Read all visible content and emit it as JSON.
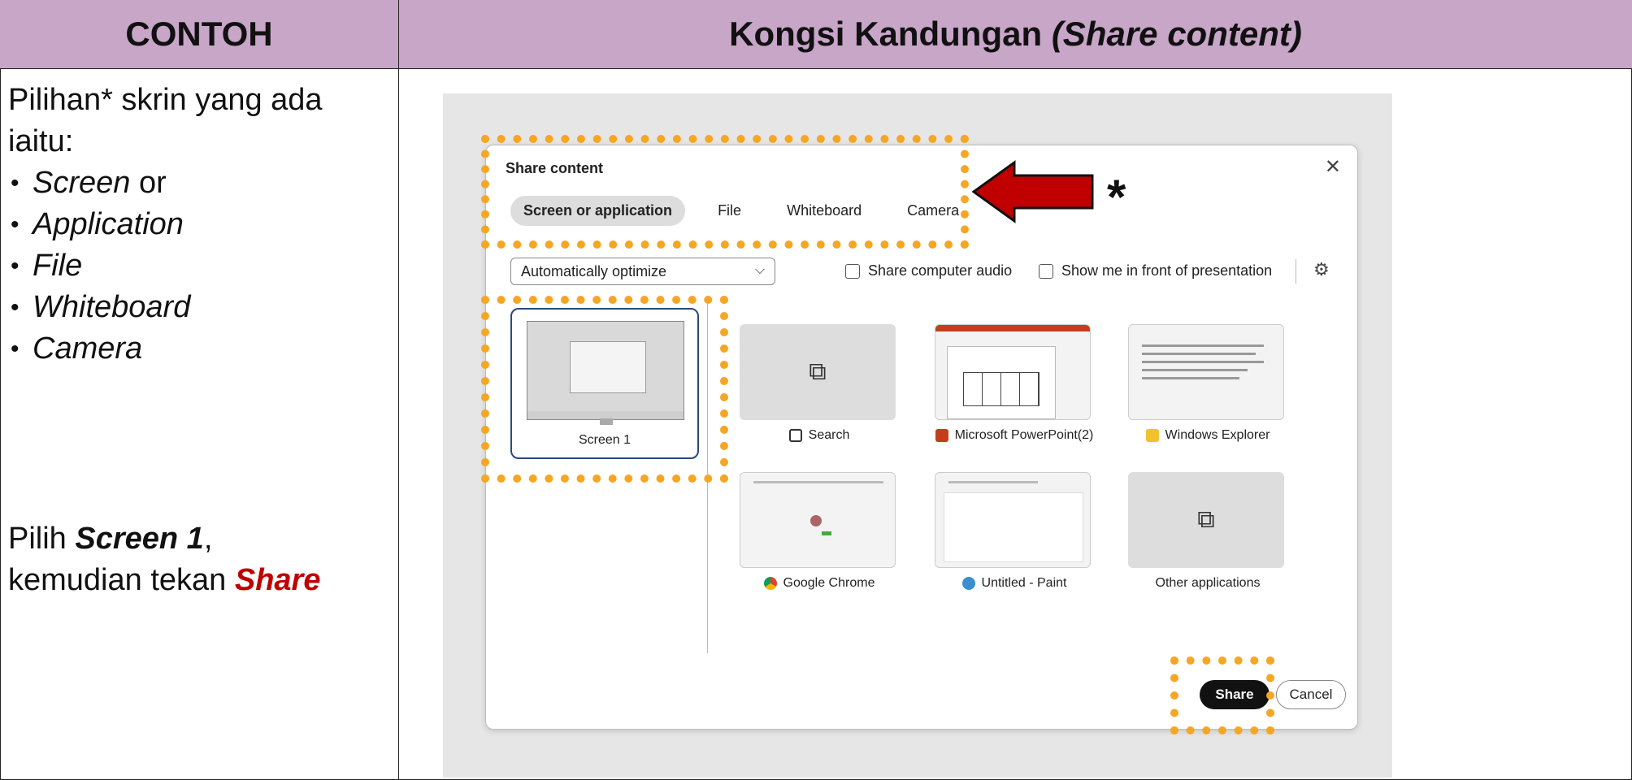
{
  "header": {
    "left": "CONTOH",
    "right_main": "Kongsi Kandungan ",
    "right_italic": "(Share content)"
  },
  "left_panel": {
    "intro": "Pilihan* skrin yang ada iaitu:",
    "options": [
      {
        "italic": "Screen",
        "plain": " or"
      },
      {
        "italic": "Application",
        "plain": ""
      },
      {
        "italic": "File",
        "plain": ""
      },
      {
        "italic": "Whiteboard",
        "plain": ""
      },
      {
        "italic": "Camera",
        "plain": ""
      }
    ],
    "instruction_prefix": "Pilih ",
    "instruction_bold": "Screen 1",
    "instruction_mid": ",",
    "instruction_mid2": "kemudian tekan ",
    "instruction_share": "Share"
  },
  "annotation": {
    "star": "*",
    "arrow_color": "#c00000",
    "highlight_color": "#f6a623"
  },
  "dialog": {
    "title": "Share content",
    "tabs": [
      "Screen or application",
      "File",
      "Whiteboard",
      "Camera"
    ],
    "active_tab": "Screen or application",
    "optimize_value": "Automatically optimize",
    "share_audio_label": "Share computer audio",
    "show_me_label": "Show me in front of presentation",
    "screen_label": "Screen 1",
    "apps": [
      {
        "label": "Search",
        "icon": "search-window-icon"
      },
      {
        "label": "Microsoft PowerPoint(2)",
        "icon": "powerpoint-icon"
      },
      {
        "label": "Windows Explorer",
        "icon": "folder-icon"
      },
      {
        "label": "Google Chrome",
        "icon": "chrome-icon"
      },
      {
        "label": "Untitled - Paint",
        "icon": "paint-icon"
      },
      {
        "label": "Other applications",
        "icon": "stacked-windows-icon"
      }
    ],
    "share_label": "Share",
    "cancel_label": "Cancel"
  }
}
